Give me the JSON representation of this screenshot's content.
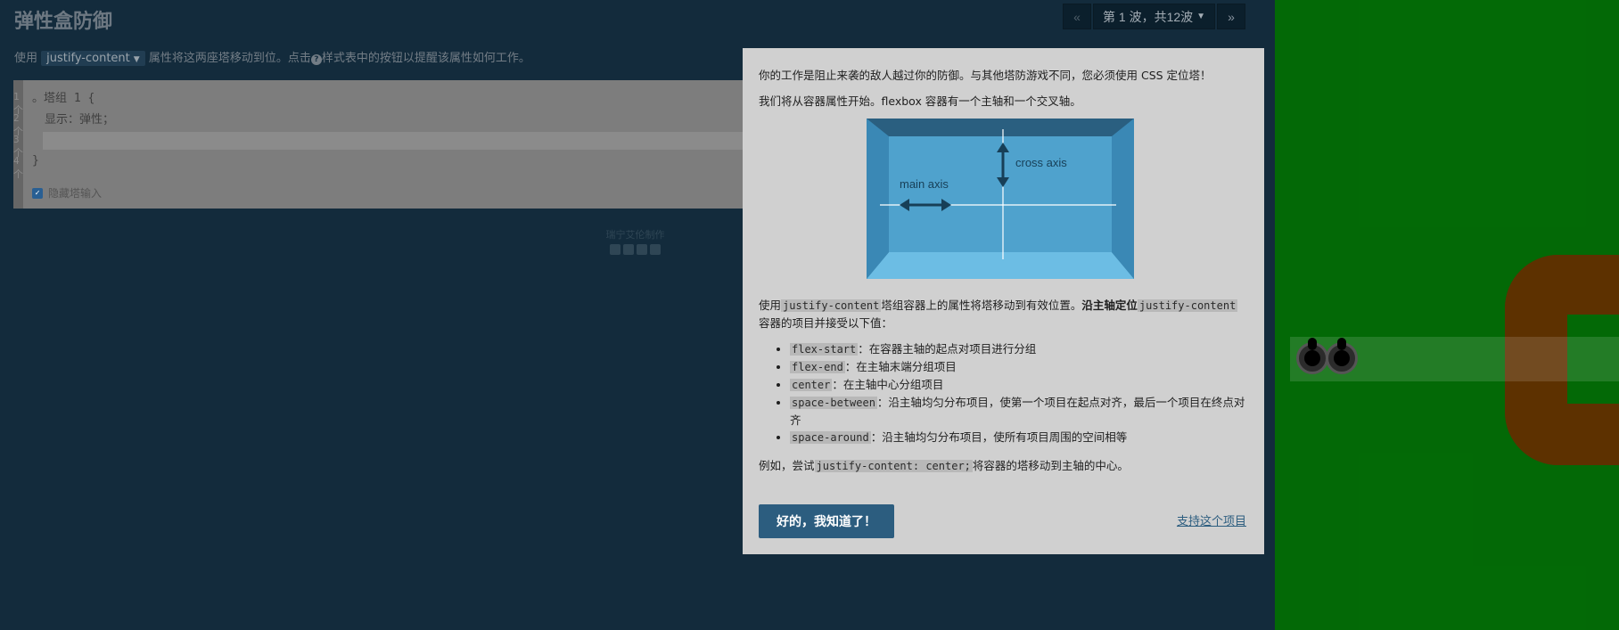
{
  "header": {
    "title": "弹性盒防御",
    "prev_label": "«",
    "wave_label": "第 1 波，共12波",
    "next_label": "»"
  },
  "instruction": {
    "prefix": "使用",
    "property_chip": "justify-content",
    "middle": "属性将这两座塔移动到位。点击",
    "suffix": "样式表中的按钮以提醒该属性如何工作。"
  },
  "editor": {
    "line_numbers": [
      "1个",
      "2个",
      "3个",
      "4个"
    ],
    "selector_line": "。塔组 1 {",
    "display_line": "显示：弹性；",
    "closing_line": "}",
    "hide_input_label": "隐藏塔输入"
  },
  "footer": {
    "credits": "瑞宁艾伦制作"
  },
  "modal": {
    "intro": "你的工作是阻止来袭的敌人越过你的防御。与其他塔防游戏不同，您必须使用 CSS 定位塔！",
    "start_text": "我们将从容器属性开始。flexbox 容器有一个主轴和一个交叉轴。",
    "diagram": {
      "cross_axis_label": "cross axis",
      "main_axis_label": "main axis"
    },
    "usage": {
      "part1": "使用",
      "code1": "justify-content",
      "part2": "塔组容器上的属性将塔移动到有效位置。",
      "bold": "沿主轴定位",
      "code2": "justify-content",
      "part3": "容器的项目并接受以下值："
    },
    "values": [
      {
        "code": "flex-start",
        "desc": "：在容器主轴的起点对项目进行分组"
      },
      {
        "code": "flex-end",
        "desc": "：在主轴末端分组项目"
      },
      {
        "code": "center",
        "desc": "：在主轴中心分组项目"
      },
      {
        "code": "space-between",
        "desc": "：沿主轴均匀分布项目，使第一个项目在起点对齐，最后一个项目在终点对齐"
      },
      {
        "code": "space-around",
        "desc": "：沿主轴均匀分布项目，使所有项目周围的空间相等"
      }
    ],
    "example": {
      "part1": "例如，尝试",
      "code": "justify-content: center;",
      "part2": "将容器的塔移动到主轴的中心。"
    },
    "ok_label": "好的，我知道了！",
    "support_label": "支持这个项目"
  },
  "colors": {
    "board_green": "#047b07",
    "path_brown": "#6d3a00",
    "primary_button": "#2c5d7f"
  }
}
